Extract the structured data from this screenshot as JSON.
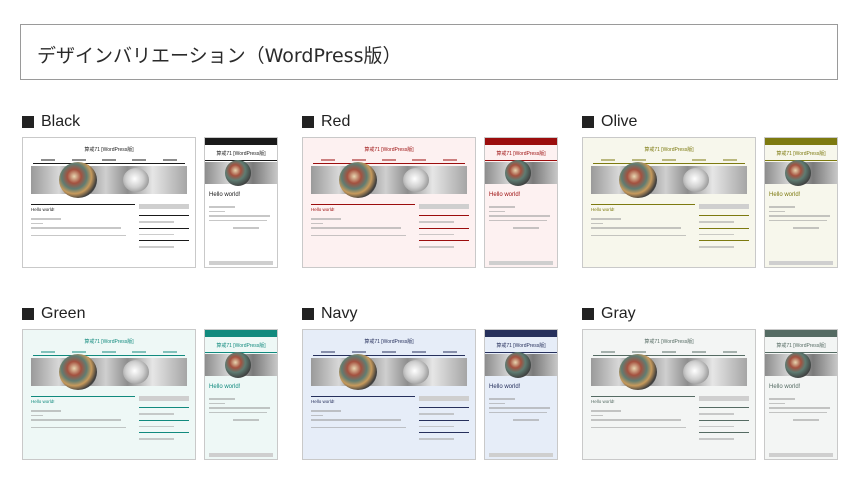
{
  "page_title": "デザインバリエーション（WordPress版）",
  "variants": [
    {
      "label": "Black",
      "accent": "#1a1a1a",
      "bg": "#ffffff",
      "post_title": "Hello world!",
      "site_title": "算戒71 [WordPress版]"
    },
    {
      "label": "Red",
      "accent": "#9b0d0d",
      "bg": "#fdf1f1",
      "post_title": "Hello world!",
      "site_title": "算戒71 [WordPress版]"
    },
    {
      "label": "Olive",
      "accent": "#7d7a10",
      "bg": "#f7f7ec",
      "post_title": "Hello world!",
      "site_title": "算戒71 [WordPress版]"
    },
    {
      "label": "Green",
      "accent": "#118a7e",
      "bg": "#eef8f6",
      "post_title": "Hello world!",
      "site_title": "算戒71 [WordPress版]"
    },
    {
      "label": "Navy",
      "accent": "#26305c",
      "bg": "#e6edf8",
      "post_title": "Hello world!",
      "site_title": "算戒71 [WordPress版]"
    },
    {
      "label": "Gray",
      "accent": "#556b63",
      "bg": "#f3f5f4",
      "post_title": "Hello world!",
      "site_title": "算戒71 [WordPress版]"
    }
  ]
}
